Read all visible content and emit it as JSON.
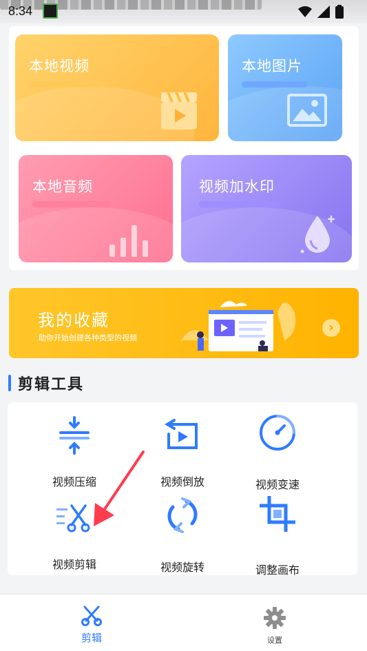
{
  "status_bar": {
    "time": "8:34"
  },
  "tiles": {
    "video": {
      "label": "本地视频"
    },
    "picture": {
      "label": "本地图片"
    },
    "audio": {
      "label": "本地音频"
    },
    "watermark": {
      "label": "视频加水印"
    }
  },
  "banner": {
    "title": "我的收藏",
    "subtitle": "助你开始创建各种类型的视频"
  },
  "section": {
    "title": "剪辑工具"
  },
  "tools": [
    {
      "label": "视频压缩",
      "icon": "compress-icon"
    },
    {
      "label": "视频倒放",
      "icon": "reverse-play-icon"
    },
    {
      "label": "视频变速",
      "icon": "speed-gauge-icon"
    },
    {
      "label": "视频剪辑",
      "icon": "scissors-cut-icon"
    },
    {
      "label": "视频旋转",
      "icon": "rotate-icon"
    },
    {
      "label": "调整画布",
      "icon": "crop-canvas-icon"
    }
  ],
  "tabbar": {
    "items": [
      {
        "label": "剪辑",
        "icon": "scissors-icon",
        "active": true
      },
      {
        "label": "设置",
        "icon": "gear-icon",
        "active": false
      }
    ]
  },
  "colors": {
    "accent": "#2f7bff",
    "banner": "#ffb300",
    "annotation_arrow": "#ff3b4f"
  }
}
